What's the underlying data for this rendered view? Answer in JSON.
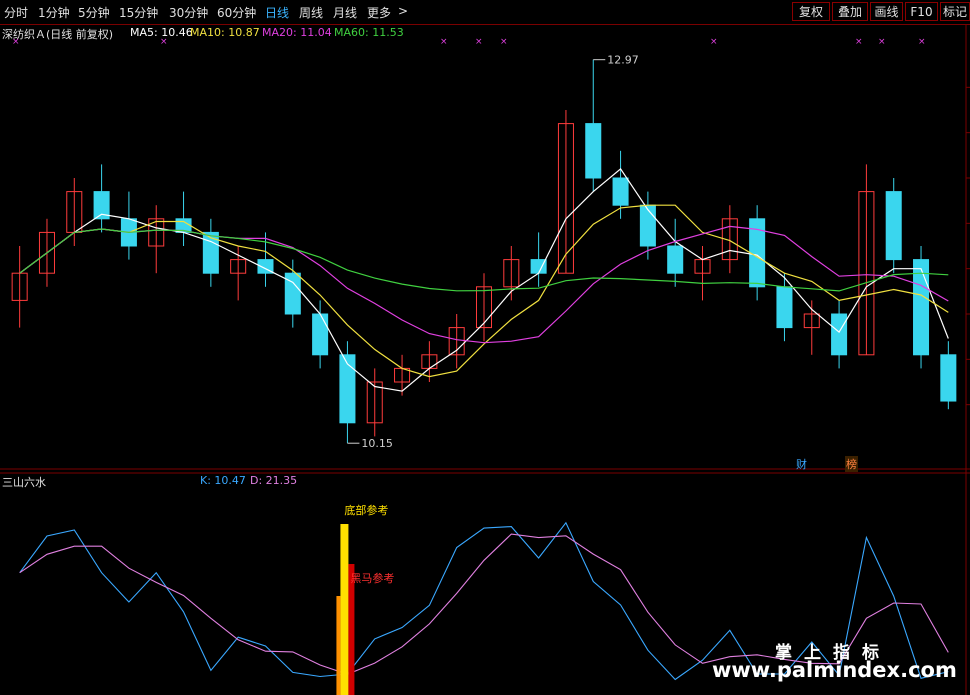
{
  "toolbar": {
    "tabs": [
      "分时",
      "1分钟",
      "5分钟",
      "15分钟",
      "30分钟",
      "60分钟",
      "日线",
      "周线",
      "月线",
      "更多"
    ],
    "more_chevron": ">",
    "right_buttons": [
      "复权",
      "叠加",
      "画线",
      "F10",
      "标记"
    ]
  },
  "legend": {
    "stock": "深纺织Ａ(日线 前复权)",
    "ma5": "MA5: 10.46",
    "ma10": "MA10: 10.87",
    "ma20": "MA20: 11.04",
    "ma60": "MA60: 11.53"
  },
  "annotations": {
    "high": "12.97",
    "low": "10.15"
  },
  "badges": {
    "cai": "财",
    "bang": "榜"
  },
  "colors": {
    "up": "#ff3c3c",
    "down": "#3ad6ee",
    "ma5": "#ffffff",
    "ma10": "#f0e040",
    "ma20": "#e040e0",
    "ma60": "#40d040",
    "k_line": "#3aa8ff",
    "d_line": "#e080e0",
    "grid": "#7a0000",
    "bottom_ref": "#ffe000",
    "darkhorse": "#d00000"
  },
  "indicator": {
    "name": "三山六水",
    "k": "K: 10.47",
    "d": "D: 21.35",
    "bottom_ref_label": "底部参考",
    "darkhorse_label": "黑马参考"
  },
  "watermark": {
    "line1": "掌上指标",
    "line2": "www.palmindex.com"
  },
  "chart_data": {
    "type": "line",
    "candles_approx": [
      [
        11.2,
        11.6,
        11.0,
        11.4
      ],
      [
        11.4,
        11.8,
        11.3,
        11.7
      ],
      [
        11.7,
        12.1,
        11.6,
        12.0
      ],
      [
        12.0,
        12.2,
        11.7,
        11.8
      ],
      [
        11.8,
        12.0,
        11.5,
        11.6
      ],
      [
        11.6,
        11.9,
        11.4,
        11.8
      ],
      [
        11.8,
        12.0,
        11.6,
        11.7
      ],
      [
        11.7,
        11.8,
        11.3,
        11.4
      ],
      [
        11.4,
        11.6,
        11.2,
        11.5
      ],
      [
        11.5,
        11.7,
        11.3,
        11.4
      ],
      [
        11.4,
        11.5,
        11.0,
        11.1
      ],
      [
        11.1,
        11.2,
        10.7,
        10.8
      ],
      [
        10.8,
        10.9,
        10.15,
        10.3
      ],
      [
        10.3,
        10.7,
        10.2,
        10.6
      ],
      [
        10.6,
        10.8,
        10.5,
        10.7
      ],
      [
        10.7,
        10.9,
        10.6,
        10.8
      ],
      [
        10.8,
        11.1,
        10.7,
        11.0
      ],
      [
        11.0,
        11.4,
        10.9,
        11.3
      ],
      [
        11.3,
        11.6,
        11.2,
        11.5
      ],
      [
        11.5,
        11.7,
        11.3,
        11.4
      ],
      [
        11.4,
        12.6,
        11.4,
        12.5
      ],
      [
        12.5,
        12.97,
        12.0,
        12.1
      ],
      [
        12.1,
        12.3,
        11.8,
        11.9
      ],
      [
        11.9,
        12.0,
        11.5,
        11.6
      ],
      [
        11.6,
        11.8,
        11.3,
        11.4
      ],
      [
        11.4,
        11.6,
        11.2,
        11.5
      ],
      [
        11.5,
        11.9,
        11.4,
        11.8
      ],
      [
        11.8,
        11.9,
        11.2,
        11.3
      ],
      [
        11.3,
        11.4,
        10.9,
        11.0
      ],
      [
        11.0,
        11.2,
        10.8,
        11.1
      ],
      [
        11.1,
        11.2,
        10.7,
        10.8
      ],
      [
        10.8,
        12.2,
        10.8,
        12.0
      ],
      [
        12.0,
        12.1,
        11.4,
        11.5
      ],
      [
        11.5,
        11.6,
        10.7,
        10.8
      ],
      [
        10.8,
        10.9,
        10.4,
        10.46
      ]
    ],
    "price_range": [
      10.1,
      13.1
    ],
    "ma_series": [
      {
        "name": "MA5",
        "value": 10.46
      },
      {
        "name": "MA10",
        "value": 10.87
      },
      {
        "name": "MA20",
        "value": 11.04
      },
      {
        "name": "MA60",
        "value": 11.53
      }
    ],
    "indicator_series": [
      {
        "name": "K",
        "last": 10.47
      },
      {
        "name": "D",
        "last": 21.35
      }
    ],
    "indicator_range": [
      0,
      100
    ]
  }
}
